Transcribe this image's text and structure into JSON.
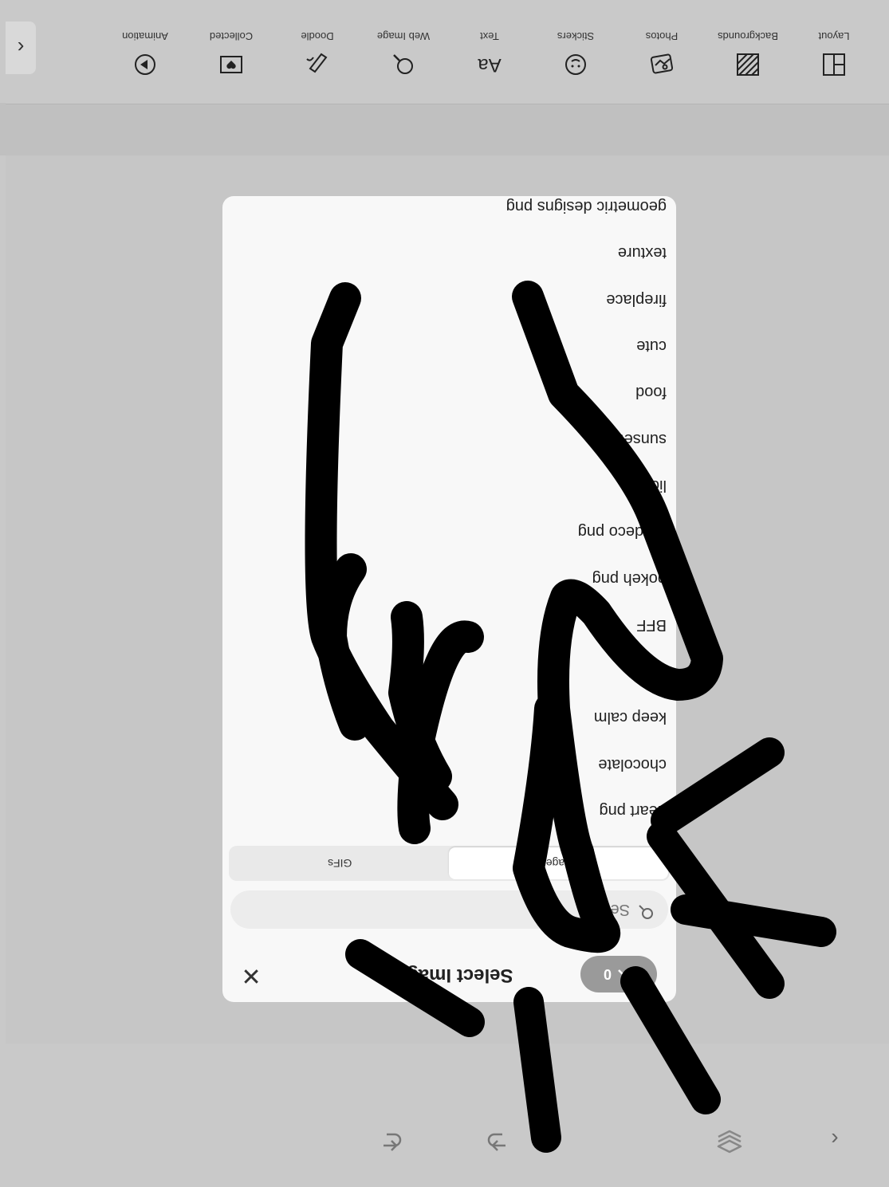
{
  "toolbar": {
    "tools": [
      {
        "label": "Layout",
        "icon": "layout-icon"
      },
      {
        "label": "Backgrounds",
        "icon": "backgrounds-icon"
      },
      {
        "label": "Photos",
        "icon": "photos-icon"
      },
      {
        "label": "Stickers",
        "icon": "stickers-icon"
      },
      {
        "label": "Text",
        "icon": "text-icon"
      },
      {
        "label": "Web Image",
        "icon": "web-image-icon"
      },
      {
        "label": "Doodle",
        "icon": "doodle-icon"
      },
      {
        "label": "Collected",
        "icon": "collected-icon"
      },
      {
        "label": "Animation",
        "icon": "animation-icon"
      }
    ],
    "collapse_glyph": "‹"
  },
  "dialog": {
    "title": "Select Images",
    "close_glyph": "✕",
    "upload_count": "0",
    "search_placeholder": "Search",
    "tabs": [
      "Images",
      "GIFs"
    ],
    "active_tab": "Images",
    "suggestions": [
      "heart png",
      "chocolate",
      "keep calm",
      "",
      "BFF",
      "bokeh png",
      "art deco png",
      "lion",
      "sunset",
      "food",
      "cute",
      "fireplace",
      "texture",
      "geometric designs png"
    ]
  },
  "bottom_nav": {
    "undo_icon": "undo-icon",
    "redo_icon": "redo-icon",
    "layers_icon": "layers-icon",
    "prev_icon": "chevron-left-icon"
  },
  "colors": {
    "background": "#c9c9c9",
    "dialog": "#f8f8f8",
    "upload_button": "#9a9a9a",
    "overlay_ink": "#000000"
  }
}
